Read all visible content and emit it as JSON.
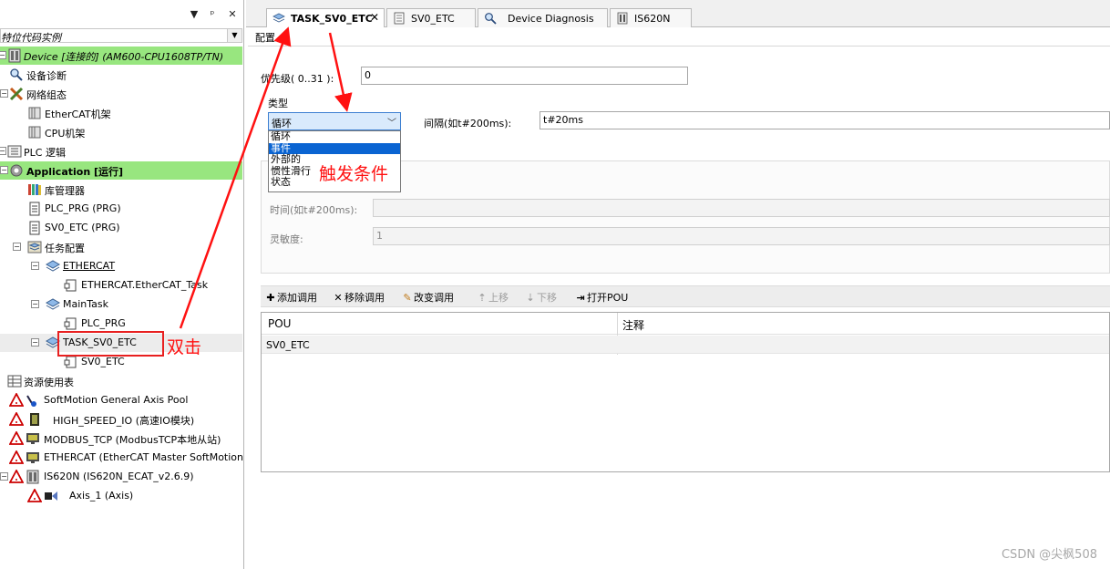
{
  "left_panel": {
    "title_controls": [
      "▼",
      "ᵖ",
      "✕"
    ],
    "project": "特位代码实例",
    "tree": [
      {
        "label": "Device [连接的] (AM600-CPU1608TP/TN)",
        "style": "it",
        "hl": true
      },
      {
        "label": "设备诊断"
      },
      {
        "label": "网络组态"
      },
      {
        "label": "EtherCAT机架"
      },
      {
        "label": "CPU机架"
      },
      {
        "label": "PLC 逻辑"
      },
      {
        "label": "Application [运行]",
        "style": "bold",
        "hl": true
      },
      {
        "label": "库管理器"
      },
      {
        "label": "PLC_PRG (PRG)"
      },
      {
        "label": "SV0_ETC (PRG)"
      },
      {
        "label": "任务配置"
      },
      {
        "label": "ETHERCAT",
        "style": "ul"
      },
      {
        "label": "ETHERCAT.EtherCAT_Task"
      },
      {
        "label": "MainTask"
      },
      {
        "label": "PLC_PRG"
      },
      {
        "label": "TASK_SV0_ETC"
      },
      {
        "label": "SV0_ETC"
      },
      {
        "label": "资源使用表"
      },
      {
        "label": "SoftMotion General Axis Pool"
      },
      {
        "label": "HIGH_SPEED_IO (高速IO模块)"
      },
      {
        "label": "MODBUS_TCP (ModbusTCP本地从站)"
      },
      {
        "label": "ETHERCAT (EtherCAT Master SoftMotion)"
      },
      {
        "label": "IS620N (IS620N_ECAT_v2.6.9)"
      },
      {
        "label": "Axis_1 (Axis)"
      }
    ]
  },
  "tabs": [
    {
      "label": "TASK_SV0_ETC",
      "close": "✕"
    },
    {
      "label": "SV0_ETC"
    },
    {
      "label": "Device Diagnosis"
    },
    {
      "label": "IS620N"
    }
  ],
  "config": {
    "section_label": "配置",
    "priority_label": "优先级( 0..31 ):",
    "priority_value": "0",
    "type_label": "类型",
    "type_selected": "循环",
    "type_options": [
      "循环",
      "事件",
      "外部的",
      "惯性滑行",
      "状态"
    ],
    "interval_label": "间隔(如t#200ms):",
    "interval_value": "t#20ms",
    "time_label": "时间(如t#200ms):",
    "time_value": "",
    "sensitivity_label": "灵敏度:",
    "sensitivity_value": "1"
  },
  "toolbar": {
    "add": "添加调用",
    "remove": "移除调用",
    "change": "改变调用",
    "up": "上移",
    "down": "下移",
    "open": "打开POU"
  },
  "grid": {
    "headers": [
      "POU",
      "注释"
    ],
    "rows": [
      [
        "SV0_ETC",
        ""
      ]
    ]
  },
  "annotations": {
    "trigger": "触发条件",
    "double_click": "双击"
  },
  "watermark": "CSDN @尖枫508",
  "colors": {
    "accent": "#98e67f",
    "annotation": "#ff1111",
    "selection": "#0a64d2"
  }
}
